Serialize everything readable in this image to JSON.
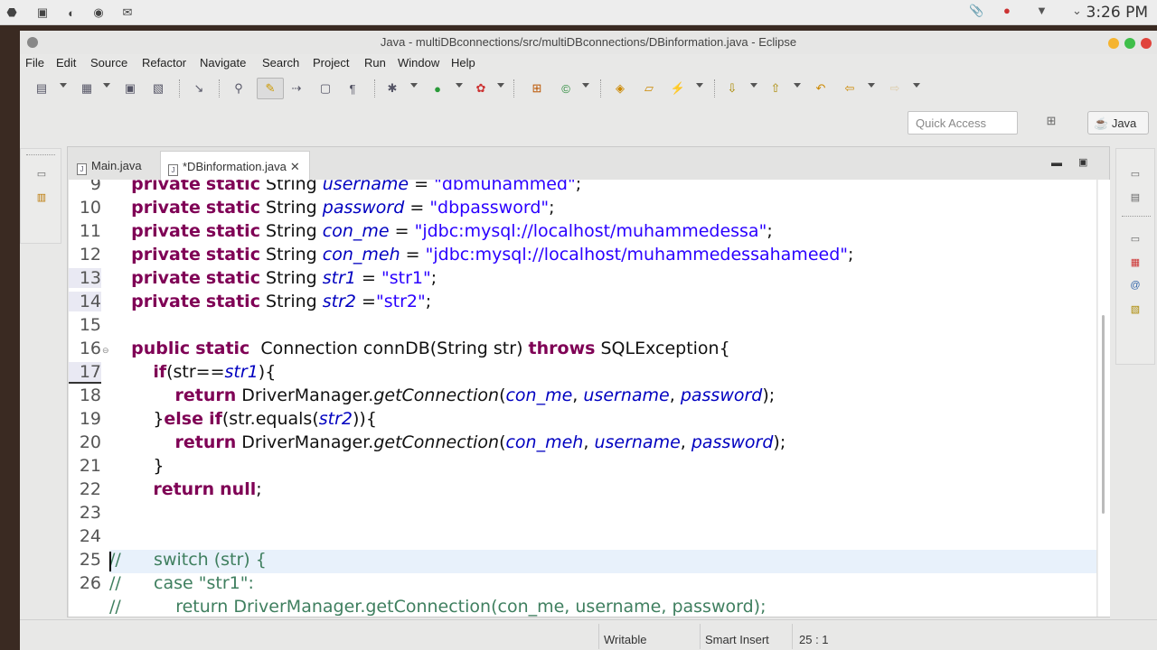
{
  "system_bar": {
    "clock": "3:26 PM"
  },
  "window": {
    "title": "Java - multiDBconnections/src/multiDBconnections/DBinformation.java - Eclipse"
  },
  "menu": [
    "File",
    "Edit",
    "Source",
    "Refactor",
    "Navigate",
    "Search",
    "Project",
    "Run",
    "Window",
    "Help"
  ],
  "quick_access": {
    "placeholder": "Quick Access"
  },
  "perspective": {
    "label": "Java"
  },
  "tabs": [
    {
      "label": "Main.java",
      "active": false
    },
    {
      "label": "*DBinformation.java",
      "active": true
    }
  ],
  "code": {
    "line_numbers": [
      "9",
      "10",
      "11",
      "12",
      "13",
      "14",
      "15",
      "16",
      "17",
      "18",
      "19",
      "20",
      "21",
      "22",
      "23",
      "24",
      "25",
      "26"
    ],
    "lines": [
      "    private static String username = \"dbmuhammed\";",
      "    private static String password = \"dbpassword\";",
      "    private static String con_me = \"jdbc:mysql://localhost/muhammedessa\";",
      "    private static String con_meh = \"jdbc:mysql://localhost/muhammedessahameed\";",
      "    private static String str1 = \"str1\";",
      "    private static String str2 =\"str2\";",
      "",
      "    public static  Connection connDB(String str) throws SQLException{",
      "        if(str==str1){",
      "            return DriverManager.getConnection(con_me, username, password);",
      "        }else if(str.equals(str2)){",
      "            return DriverManager.getConnection(con_meh, username, password);",
      "        }",
      "        return null;",
      "",
      "",
      "//      switch (str) {",
      "//      case \"str1\":"
    ],
    "partial_line": "//          return DriverManager.getConnection(con_me, username, password);"
  },
  "status": {
    "writable": "Writable",
    "insert_mode": "Smart Insert",
    "position": "25 : 1"
  },
  "colors": {
    "keyword": "#7f0055",
    "field": "#0000c0",
    "string": "#2a00ff",
    "comment": "#3f7f5f",
    "current_line": "#e8f1fb"
  }
}
